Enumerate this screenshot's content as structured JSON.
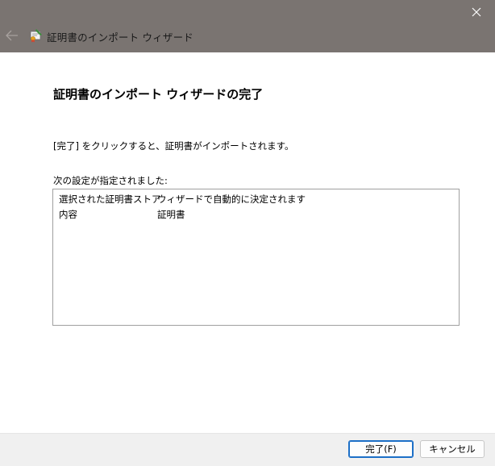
{
  "window": {
    "title": "証明書のインポート ウィザード",
    "titlebar_color": "#7a7471"
  },
  "icons": {
    "close": "close-icon",
    "back": "back-arrow-icon",
    "wizard": "certificate-wizard-icon"
  },
  "main": {
    "heading": "証明書のインポート ウィザードの完了",
    "description": "[完了] をクリックすると、証明書がインポートされます。",
    "settings_label": "次の設定が指定されました:",
    "settings": [
      {
        "key": "選択された証明書ストア",
        "value": "ウィザードで自動的に決定されます"
      },
      {
        "key": "内容",
        "value": "証明書"
      }
    ]
  },
  "footer": {
    "finish_label": "完了(F)",
    "cancel_label": "キャンセル",
    "accent": "#1c6fc7"
  }
}
